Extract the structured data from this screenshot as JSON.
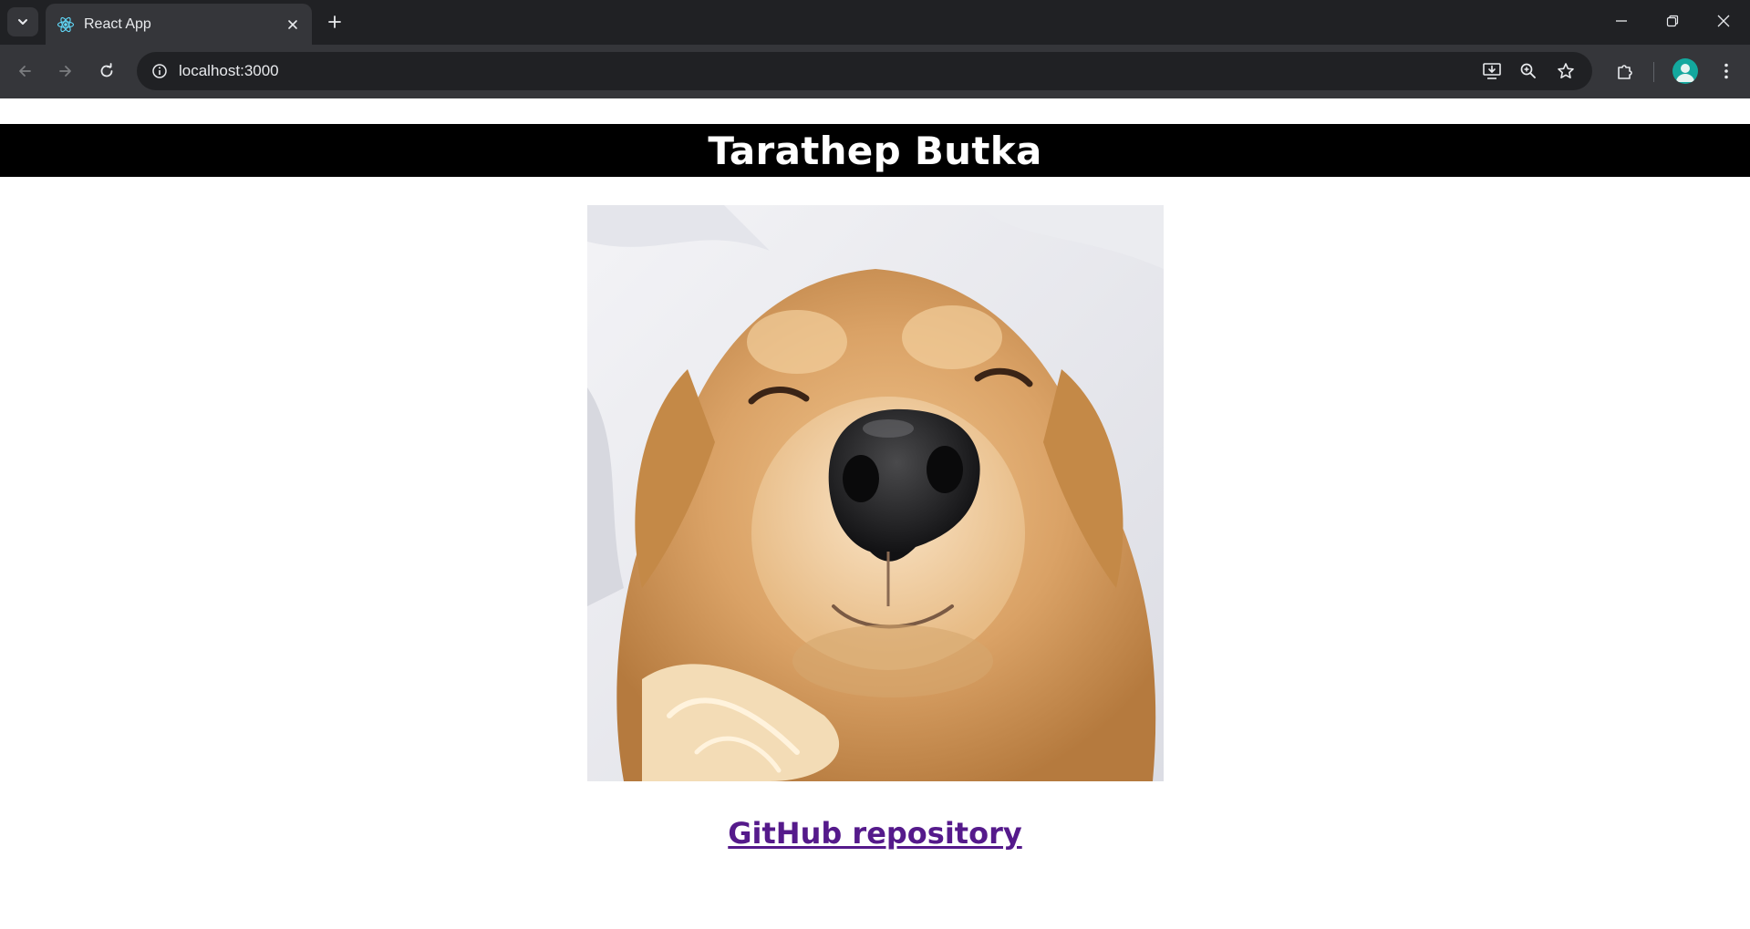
{
  "browser": {
    "tab_title": "React App",
    "url": "localhost:3000",
    "icons": {
      "tab_search": "chevron-down-icon",
      "favicon": "react-logo-icon",
      "tab_close": "close-icon",
      "new_tab": "plus-icon",
      "minimize": "minimize-icon",
      "restore": "restore-icon",
      "close_window": "close-icon",
      "back": "arrow-left-icon",
      "forward": "arrow-right-icon",
      "reload": "reload-icon",
      "site_info": "info-icon",
      "install_app": "install-icon",
      "zoom": "zoom-icon",
      "bookmark": "star-icon",
      "extensions": "puzzle-icon",
      "profile": "avatar",
      "menu": "kebab-menu-icon"
    }
  },
  "page": {
    "header_title": "Tarathep Butka",
    "link_text": "GitHub repository",
    "colors": {
      "header_bg": "#000000",
      "header_text": "#ffffff",
      "link": "#551a8b"
    }
  }
}
